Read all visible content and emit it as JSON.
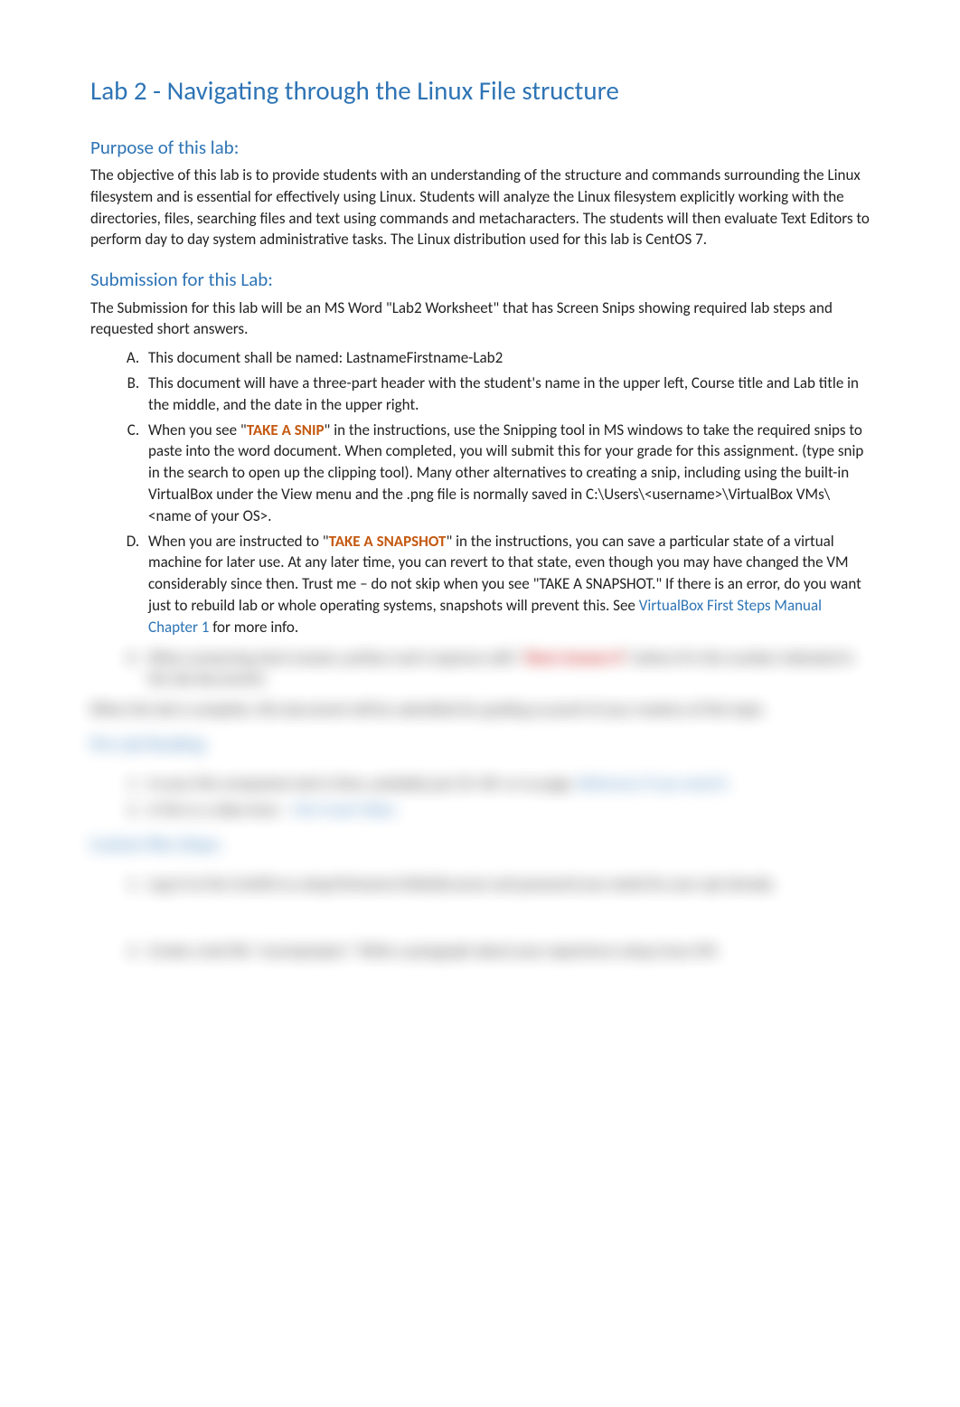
{
  "title": "Lab 2 - Navigating through the Linux File structure",
  "purpose": {
    "heading": "Purpose of this lab:",
    "text": "The objective of this lab is to provide students with an understanding of the structure and commands surrounding the Linux filesystem and is essential for effectively using Linux. Students will analyze the Linux filesystem explicitly working with the directories, files, searching files and text using commands and metacharacters. The students will then evaluate Text Editors to perform day to day system administrative tasks. The Linux distribution used for this lab is CentOS 7."
  },
  "submission": {
    "heading": "Submission for this Lab:",
    "intro": "The Submission for this lab will be an MS Word \"Lab2 Worksheet\" that has Screen Snips showing required lab steps and requested short answers.",
    "items": {
      "a": "This document shall be named: LastnameFirstname-Lab2",
      "b": "This document will have a three-part header with the student's name in the upper left, Course title and Lab title in the middle, and the date in the upper right.",
      "c_pre": "When you see \"",
      "c_snip": "TAKE A SNIP",
      "c_post": "\" in the instructions, use the Snipping tool in MS windows to take the required snips to paste into the word document.  When completed, you will submit this for your grade for this assignment. (type snip in the search to open up the clipping tool).  Many other alternatives to creating a snip, including using the built-in VirtualBox under the View menu and the .png file is normally saved in C:\\Users\\<username>\\VirtualBox VMs\\<name of your OS>.",
      "d_pre": "When you are instructed to \"",
      "d_snap": "TAKE A SNAPSHOT",
      "d_mid": "\" in the instructions, you can save a particular state of a virtual machine for later use. At any later time, you can revert to that state, even though you may have changed the VM considerably since then. Trust me – do not skip when you see \"TAKE A SNAPSHOT.\" If there is an error, do you want just to rebuild lab or whole operating systems, snapshots will prevent this. See ",
      "d_link": "VirtualBox First Steps Manual Chapter 1",
      "d_end": " for more info."
    }
  },
  "blurred": {
    "e_pre": "When answering short answer, preface each response with \"",
    "e_red": "Short Answer #",
    "e_post": "\" (where # is the number indicated in the lab document).",
    "summary": "When the lab is complete, this document will be submitted for grading as proof of your mastery of this topic.",
    "prelab_h": "Pre-Lab Reading:",
    "prelab_1a": "In your this companion text is time, probably just 10–40+ or so page. ",
    "prelab_1b": "Reference if you need it.",
    "prelab_2a": "A Vim is a video here – ",
    "prelab_2b": "Vim Crash Video",
    "custom_h": "Custom files Steps:",
    "step1": "Log-in to the CentOS as using firstname/initial@course and password you noted for your apt already.",
    "step2": "Create a text file \"courseproject.\" Write a paragraph about your experience setup Linux VM."
  }
}
